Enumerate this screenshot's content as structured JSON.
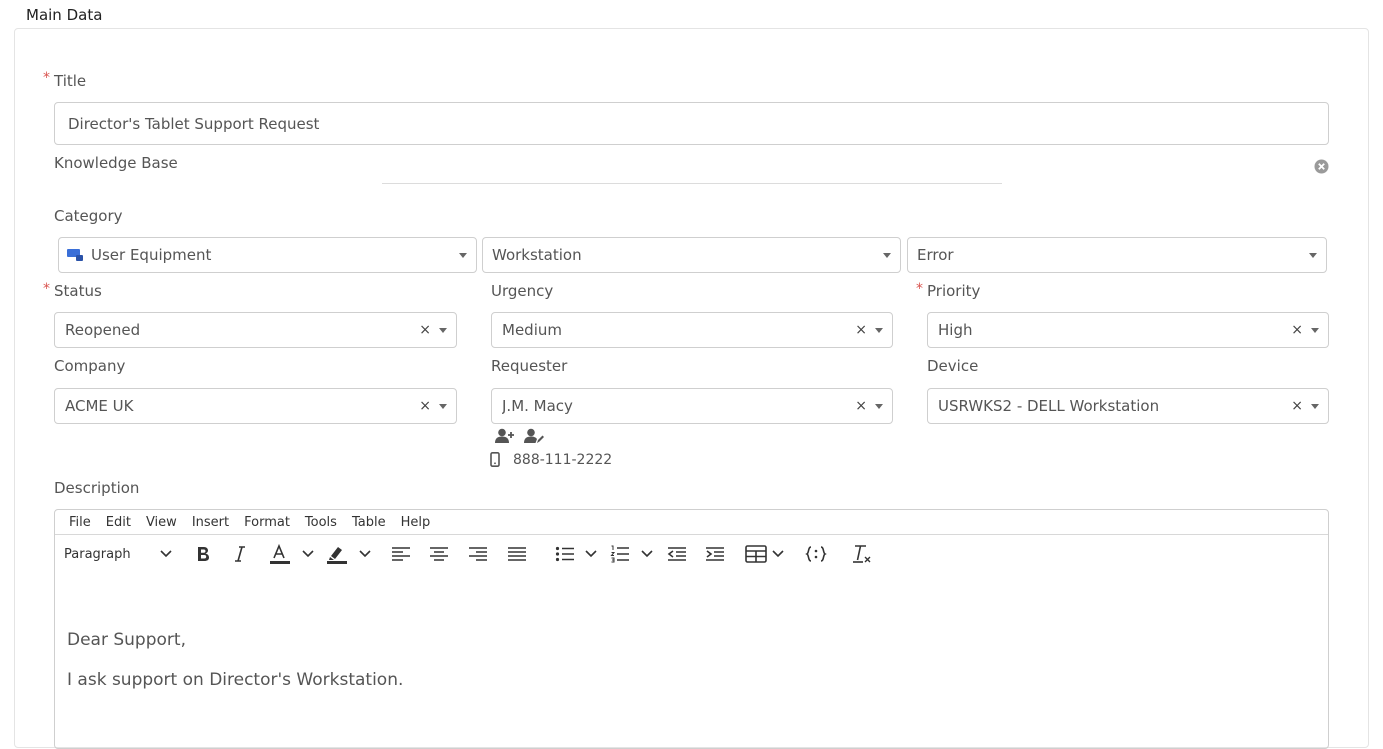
{
  "section_title": "Main Data",
  "title_field": {
    "label": "Title",
    "value": "Director's Tablet Support Request",
    "required": true
  },
  "knowledge_base": {
    "label": "Knowledge Base"
  },
  "category": {
    "label": "Category",
    "level1": "User Equipment",
    "level2": "Workstation",
    "level3": "Error"
  },
  "status": {
    "label": "Status",
    "value": "Reopened",
    "required": true
  },
  "urgency": {
    "label": "Urgency",
    "value": "Medium"
  },
  "priority": {
    "label": "Priority",
    "value": "High",
    "required": true
  },
  "company": {
    "label": "Company",
    "value": "ACME UK"
  },
  "requester": {
    "label": "Requester",
    "value": "J.M. Macy",
    "phone": "888-111-2222"
  },
  "device": {
    "label": "Device",
    "value": "USRWKS2 - DELL Workstation"
  },
  "description": {
    "label": "Description",
    "menu": [
      "File",
      "Edit",
      "View",
      "Insert",
      "Format",
      "Tools",
      "Table",
      "Help"
    ],
    "block_format": "Paragraph",
    "paragraphs": [
      "Dear Support,",
      "I ask support on Director's Workstation."
    ]
  },
  "common": {
    "required_mark": "*",
    "clear_mark": "×"
  },
  "colors": {
    "required": "#d9534f",
    "border": "#cfcfcf",
    "category_icon": "#3a6fd8"
  }
}
